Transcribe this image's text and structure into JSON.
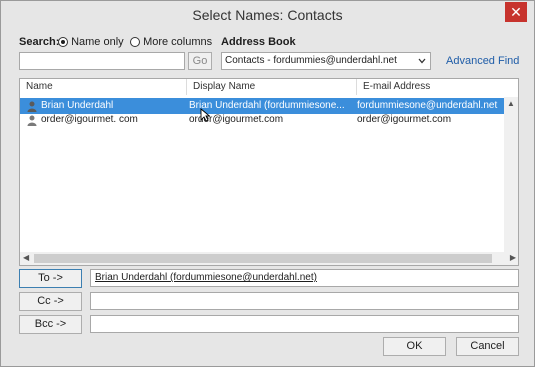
{
  "window": {
    "title": "Select Names: Contacts",
    "close_symbol": "✕"
  },
  "search": {
    "label": "Search:",
    "option_name_only": "Name only",
    "option_more_columns": "More columns",
    "selected_option": "Name only",
    "input_value": "",
    "go_label": "Go"
  },
  "address_book": {
    "label": "Address Book",
    "selected": "Contacts - fordummies@underdahl.net",
    "advanced_find": "Advanced Find"
  },
  "list": {
    "columns": [
      "Name",
      "Display Name",
      "E-mail Address"
    ],
    "rows": [
      {
        "name": "Brian Underdahl",
        "display_name": "Brian Underdahl (fordummiesone...",
        "email": "fordummiesone@underdahl.net",
        "selected": true
      },
      {
        "name": "order@igourmet. com",
        "display_name": "order@igourmet.com",
        "email": "order@igourmet.com",
        "selected": false
      }
    ]
  },
  "recipients": {
    "to_label": "To ->",
    "to_value": "Brian Underdahl (fordummiesone@underdahl.net)",
    "cc_label": "Cc ->",
    "cc_value": "",
    "bcc_label": "Bcc ->",
    "bcc_value": ""
  },
  "footer": {
    "ok_label": "OK",
    "cancel_label": "Cancel"
  },
  "colors": {
    "selection": "#3b8edb",
    "close_button": "#c7332d",
    "link": "#1f5da8"
  }
}
